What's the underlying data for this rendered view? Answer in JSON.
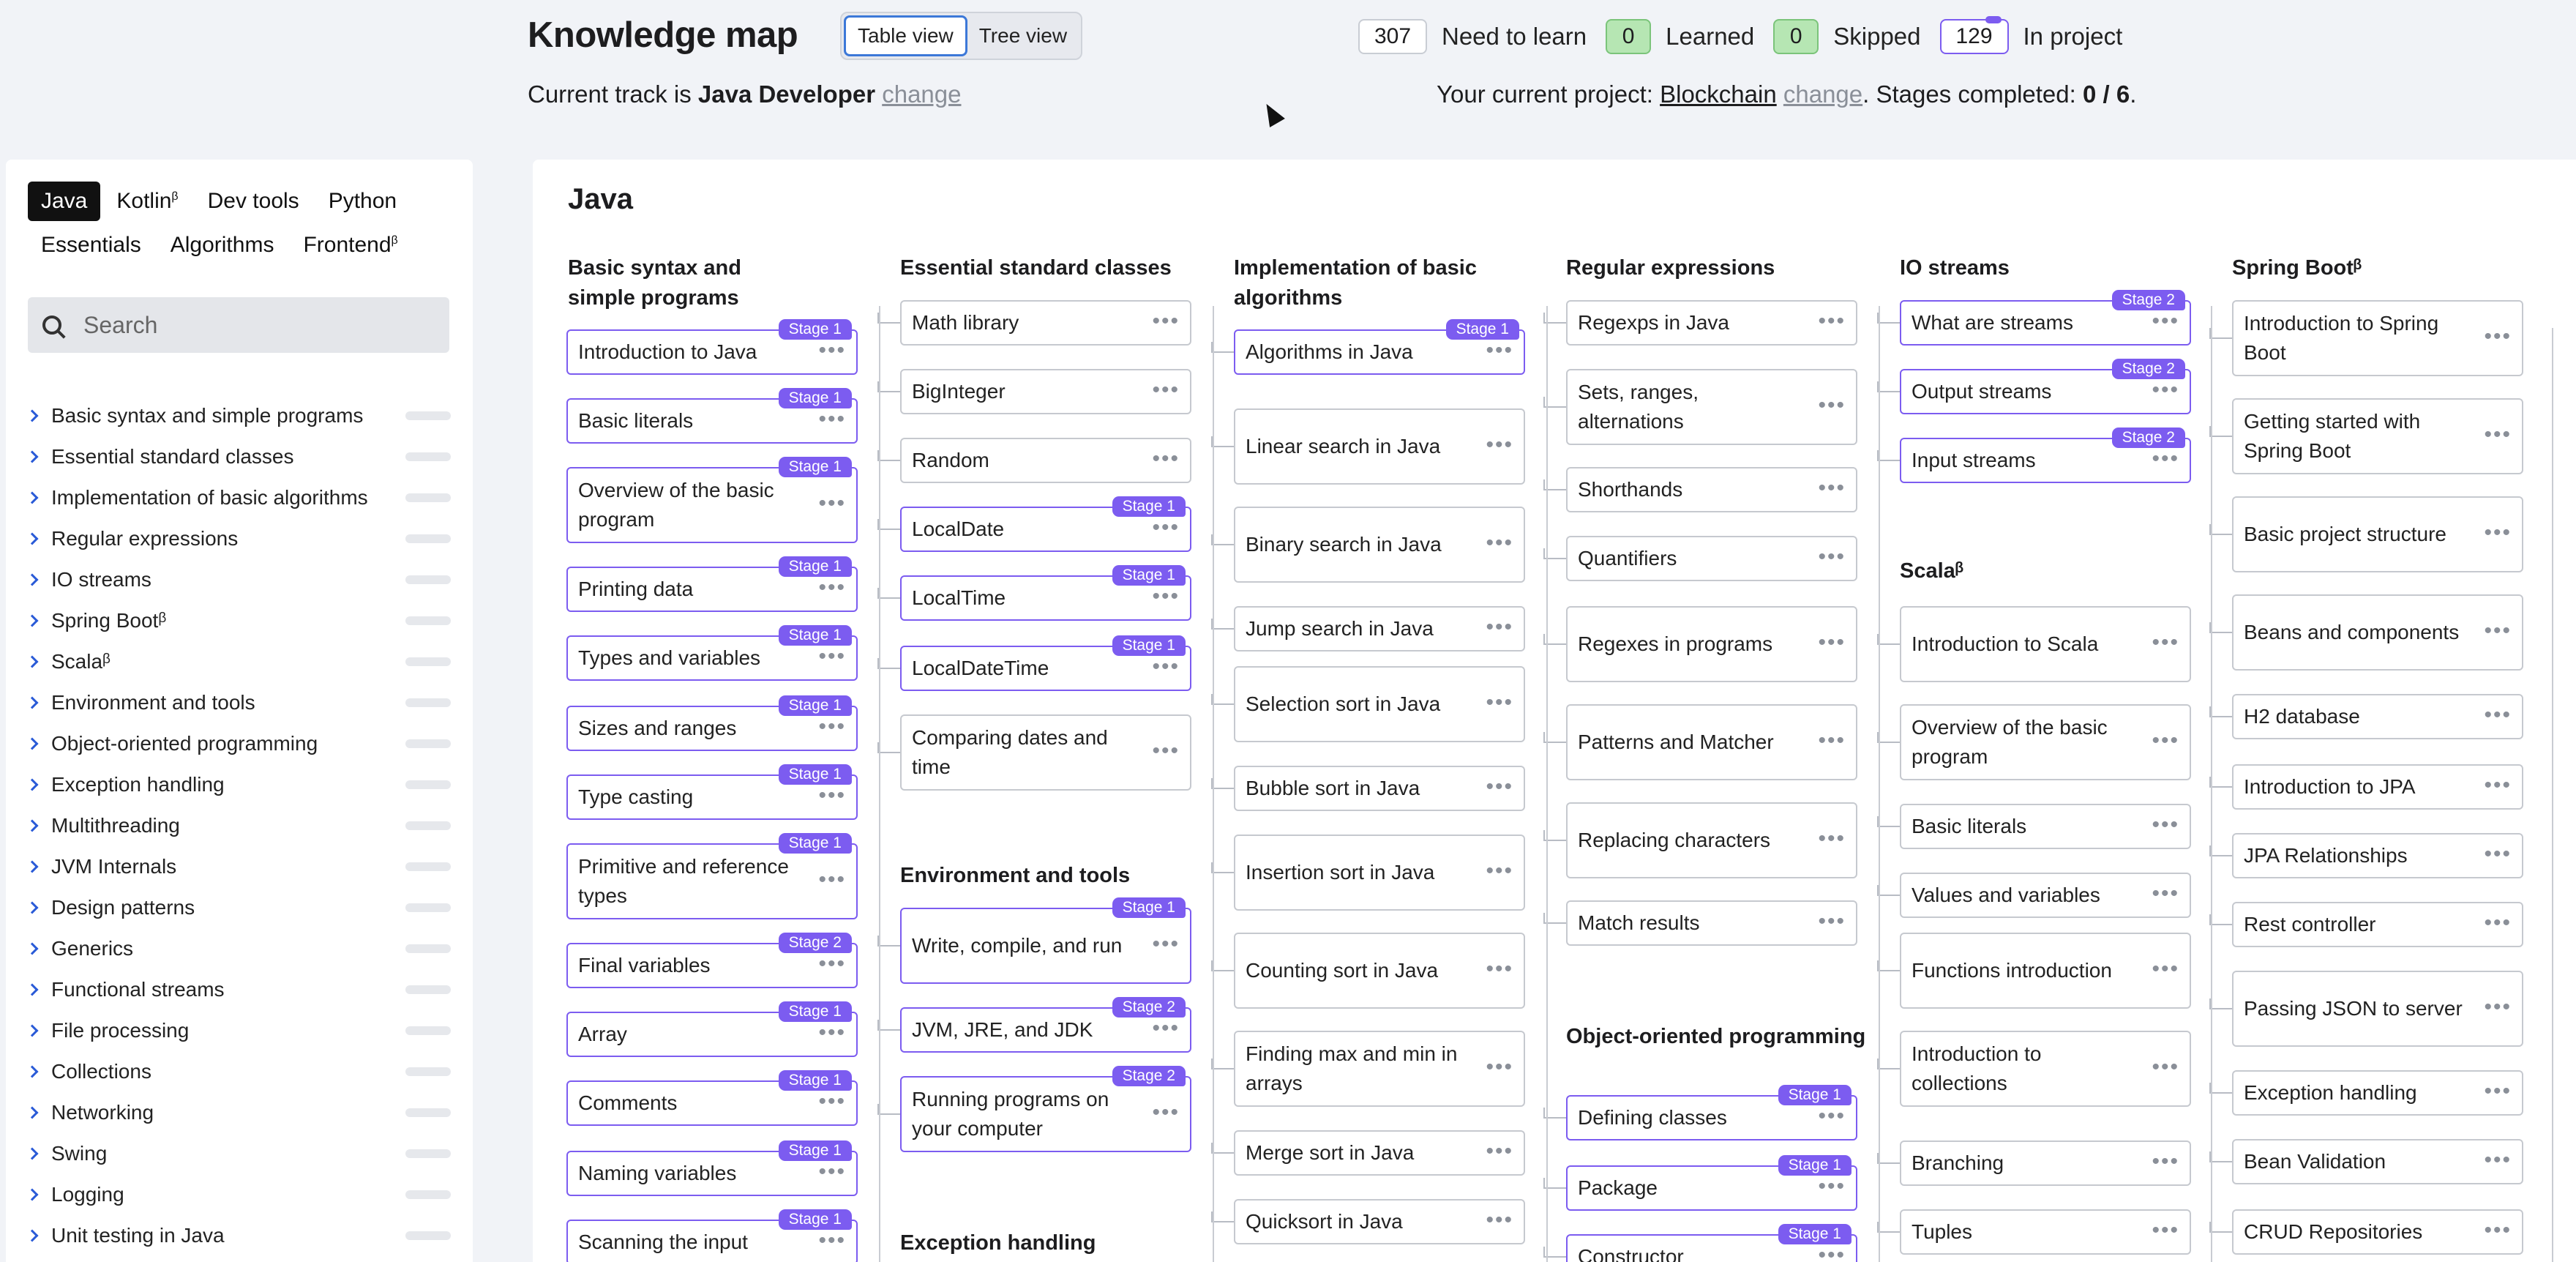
{
  "header": {
    "title": "Knowledge map",
    "views": [
      "Table view",
      "Tree view"
    ],
    "track_prefix": "Current track is ",
    "track": "Java Developer",
    "track_change": "change",
    "stats": [
      {
        "count": "307",
        "label": "Need to learn"
      },
      {
        "count": "0",
        "label": "Learned"
      },
      {
        "count": "0",
        "label": "Skipped"
      },
      {
        "count": "129",
        "label": "In project"
      }
    ],
    "project_prefix": "Your current project: ",
    "project": "Blockchain",
    "project_change": "change",
    "stages_text": ". Stages completed: ",
    "stages_value": "0 / 6",
    "stages_end": "."
  },
  "sidebar": {
    "tabs": [
      {
        "label": "Java",
        "beta": ""
      },
      {
        "label": "Kotlin",
        "beta": "β"
      },
      {
        "label": "Dev tools",
        "beta": ""
      },
      {
        "label": "Python",
        "beta": ""
      },
      {
        "label": "Essentials",
        "beta": ""
      },
      {
        "label": "Algorithms",
        "beta": ""
      },
      {
        "label": "Frontend",
        "beta": "β"
      }
    ],
    "search_placeholder": "Search",
    "items": [
      "Basic syntax and simple programs",
      "Essential standard classes",
      "Implementation of basic algorithms",
      "Regular expressions",
      "IO streams",
      "Spring Bootᵝ",
      "Scalaᵝ",
      "Environment and tools",
      "Object-oriented programming",
      "Exception handling",
      "Multithreading",
      "JVM Internals",
      "Design patterns",
      "Generics",
      "Functional streams",
      "File processing",
      "Collections",
      "Networking",
      "Swing",
      "Logging",
      "Unit testing in Java"
    ]
  },
  "main": {
    "title": "Java",
    "columns": [
      {
        "title": "Basic syntax and simple programs"
      },
      {
        "title": "Essential standard classes"
      },
      {
        "title": "Implementation of basic algorithms"
      },
      {
        "title": "Regular expressions"
      },
      {
        "title": "IO streams"
      },
      {
        "title": "Spring Bootᵝ"
      },
      {
        "title": "Environment and tools"
      },
      {
        "title": "Scalaᵝ"
      },
      {
        "title": "Object-oriented programming"
      },
      {
        "title": "Exception handling"
      }
    ],
    "cards": {
      "c1": [
        {
          "label": "Introduction to Java",
          "badge": "Stage 1"
        },
        {
          "label": "Basic literals",
          "badge": "Stage 1"
        },
        {
          "label": "Overview of the basic program",
          "badge": "Stage 1"
        },
        {
          "label": "Printing data",
          "badge": "Stage 1"
        },
        {
          "label": "Types and variables",
          "badge": "Stage 1"
        },
        {
          "label": "Sizes and ranges",
          "badge": "Stage 1"
        },
        {
          "label": "Type casting",
          "badge": "Stage 1"
        },
        {
          "label": "Primitive and reference types",
          "badge": "Stage 1"
        },
        {
          "label": "Final variables",
          "badge": "Stage 2"
        },
        {
          "label": "Array",
          "badge": "Stage 1"
        },
        {
          "label": "Comments",
          "badge": "Stage 1"
        },
        {
          "label": "Naming variables",
          "badge": "Stage 1"
        },
        {
          "label": "Scanning the input",
          "badge": "Stage 1"
        }
      ],
      "c2": [
        {
          "label": "Math library",
          "badge": ""
        },
        {
          "label": "BigInteger",
          "badge": ""
        },
        {
          "label": "Random",
          "badge": ""
        },
        {
          "label": "LocalDate",
          "badge": "Stage 1"
        },
        {
          "label": "LocalTime",
          "badge": "Stage 1"
        },
        {
          "label": "LocalDateTime",
          "badge": "Stage 1"
        },
        {
          "label": "Comparing dates and time",
          "badge": ""
        }
      ],
      "c2b": [
        {
          "label": "Write, compile, and run",
          "badge": "Stage 1"
        },
        {
          "label": "JVM, JRE, and JDK",
          "badge": "Stage 2"
        },
        {
          "label": "Running programs on your computer",
          "badge": "Stage 2"
        }
      ],
      "c3": [
        {
          "label": "Algorithms in Java",
          "badge": "Stage 1"
        },
        {
          "label": "Linear search in Java",
          "badge": ""
        },
        {
          "label": "Binary search in Java",
          "badge": ""
        },
        {
          "label": "Jump search in Java",
          "badge": ""
        },
        {
          "label": "Selection sort in Java",
          "badge": ""
        },
        {
          "label": "Bubble sort in Java",
          "badge": ""
        },
        {
          "label": "Insertion sort in Java",
          "badge": ""
        },
        {
          "label": "Counting sort in Java",
          "badge": ""
        },
        {
          "label": "Finding max and min in arrays",
          "badge": ""
        },
        {
          "label": "Merge sort in Java",
          "badge": ""
        },
        {
          "label": "Quicksort in Java",
          "badge": ""
        }
      ],
      "c4": [
        {
          "label": "Regexps in Java",
          "badge": ""
        },
        {
          "label": "Sets, ranges, alternations",
          "badge": ""
        },
        {
          "label": "Shorthands",
          "badge": ""
        },
        {
          "label": "Quantifiers",
          "badge": ""
        },
        {
          "label": "Regexes in programs",
          "badge": ""
        },
        {
          "label": "Patterns and Matcher",
          "badge": ""
        },
        {
          "label": "Replacing characters",
          "badge": ""
        },
        {
          "label": "Match results",
          "badge": ""
        }
      ],
      "c4b": [
        {
          "label": "Defining classes",
          "badge": "Stage 1"
        },
        {
          "label": "Package",
          "badge": "Stage 1"
        },
        {
          "label": "Constructor",
          "badge": "Stage 1"
        }
      ],
      "c5": [
        {
          "label": "What are streams",
          "badge": "Stage 2"
        },
        {
          "label": "Output streams",
          "badge": "Stage 2"
        },
        {
          "label": "Input streams",
          "badge": "Stage 2"
        }
      ],
      "c5b": [
        {
          "label": "Introduction to Scala",
          "badge": ""
        },
        {
          "label": "Overview of the basic program",
          "badge": ""
        },
        {
          "label": "Basic literals",
          "badge": ""
        },
        {
          "label": "Values and variables",
          "badge": ""
        },
        {
          "label": "Functions introduction",
          "badge": ""
        },
        {
          "label": "Introduction to collections",
          "badge": ""
        },
        {
          "label": "Branching",
          "badge": ""
        },
        {
          "label": "Tuples",
          "badge": ""
        }
      ],
      "c6": [
        {
          "label": "Introduction to Spring Boot",
          "badge": ""
        },
        {
          "label": "Getting started with Spring Boot",
          "badge": ""
        },
        {
          "label": "Basic project structure",
          "badge": ""
        },
        {
          "label": "Beans and components",
          "badge": ""
        },
        {
          "label": "H2 database",
          "badge": ""
        },
        {
          "label": "Introduction to JPA",
          "badge": ""
        },
        {
          "label": "JPA Relationships",
          "badge": ""
        },
        {
          "label": "Rest controller",
          "badge": ""
        },
        {
          "label": "Passing JSON to server",
          "badge": ""
        },
        {
          "label": "Exception handling",
          "badge": ""
        },
        {
          "label": "Bean Validation",
          "badge": ""
        },
        {
          "label": "CRUD Repositories",
          "badge": ""
        }
      ]
    },
    "card_menu": "•••"
  }
}
